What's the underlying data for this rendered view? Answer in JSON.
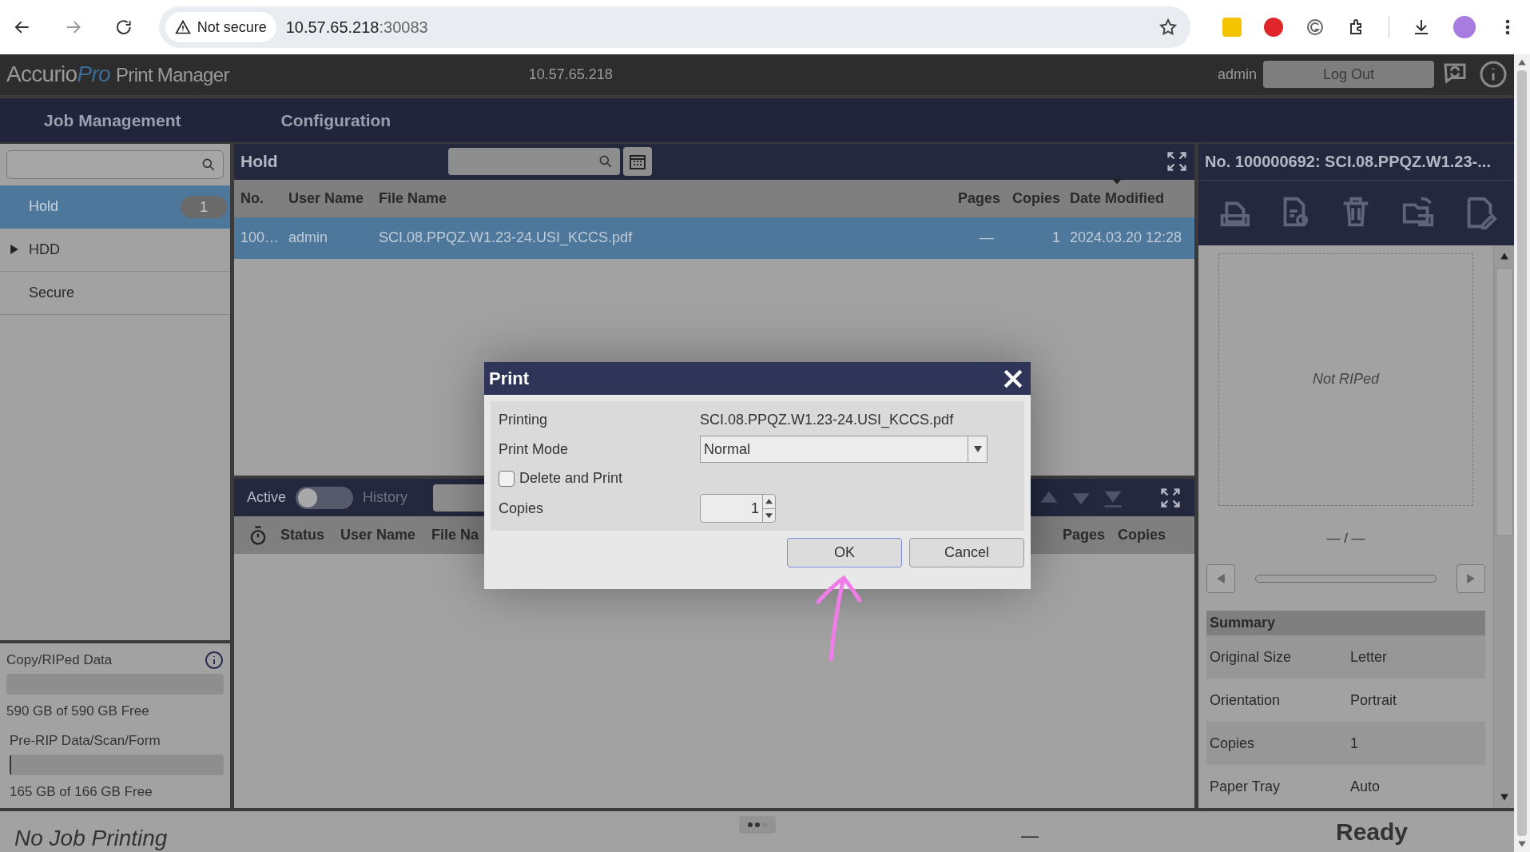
{
  "browser": {
    "security_label": "Not secure",
    "url_host": "10.57.65.218",
    "url_port": ":30083"
  },
  "header": {
    "logo_brand": "Accurio",
    "logo_brand_suffix": "Pro",
    "logo_product": "Print Manager",
    "host": "10.57.65.218",
    "user": "admin",
    "logout": "Log Out"
  },
  "nav": [
    "Job Management",
    "Configuration"
  ],
  "sidebar": {
    "items": [
      {
        "label": "Hold",
        "count": "1",
        "selected": true,
        "expandable": false
      },
      {
        "label": "HDD",
        "selected": false,
        "expandable": true
      },
      {
        "label": "Secure",
        "selected": false,
        "expandable": false
      }
    ],
    "storage": [
      {
        "label": "Copy/RIPed Data",
        "level": 0,
        "free": "590 GB of 590 GB Free"
      },
      {
        "label": "Pre-RIP Data/Scan/Form",
        "level": 0.005,
        "free": "165 GB of 166 GB Free"
      }
    ]
  },
  "hold": {
    "title": "Hold",
    "columns": [
      "No.",
      "User Name",
      "File Name",
      "Pages",
      "Copies",
      "Date Modified"
    ],
    "rows": [
      {
        "cells": [
          "100…",
          "admin",
          "SCI.08.PPQZ.W1.23-24.USI_KCCS.pdf",
          "—",
          "1",
          "2024.03.20 12:28"
        ],
        "selected": true
      }
    ]
  },
  "queue": {
    "toggle_left": "Active",
    "toggle_right": "History",
    "on": false,
    "columns": [
      "Status",
      "User Name",
      "File Na",
      "Pages",
      "Copies"
    ]
  },
  "details": {
    "title": "No. 100000692: SCI.08.PPQZ.W1.23-...",
    "preview": "Not RIPed",
    "page": "— / —",
    "summary_title": "Summary",
    "summary": [
      {
        "label": "Original Size",
        "value": "Letter"
      },
      {
        "label": "Orientation",
        "value": "Portrait"
      },
      {
        "label": "Copies",
        "value": "1"
      },
      {
        "label": "Paper Tray",
        "value": "Auto"
      }
    ]
  },
  "status_bar": {
    "job": "No Job Printing",
    "dash": "—",
    "state": "Ready"
  },
  "dialog": {
    "title": "Print",
    "printing_label": "Printing",
    "printing_value": "SCI.08.PPQZ.W1.23-24.USI_KCCS.pdf",
    "mode_label": "Print Mode",
    "mode_value": "Normal",
    "delete_label": "Delete and Print",
    "delete_checked": false,
    "copies_label": "Copies",
    "copies_value": "1",
    "ok": "OK",
    "cancel": "Cancel"
  }
}
